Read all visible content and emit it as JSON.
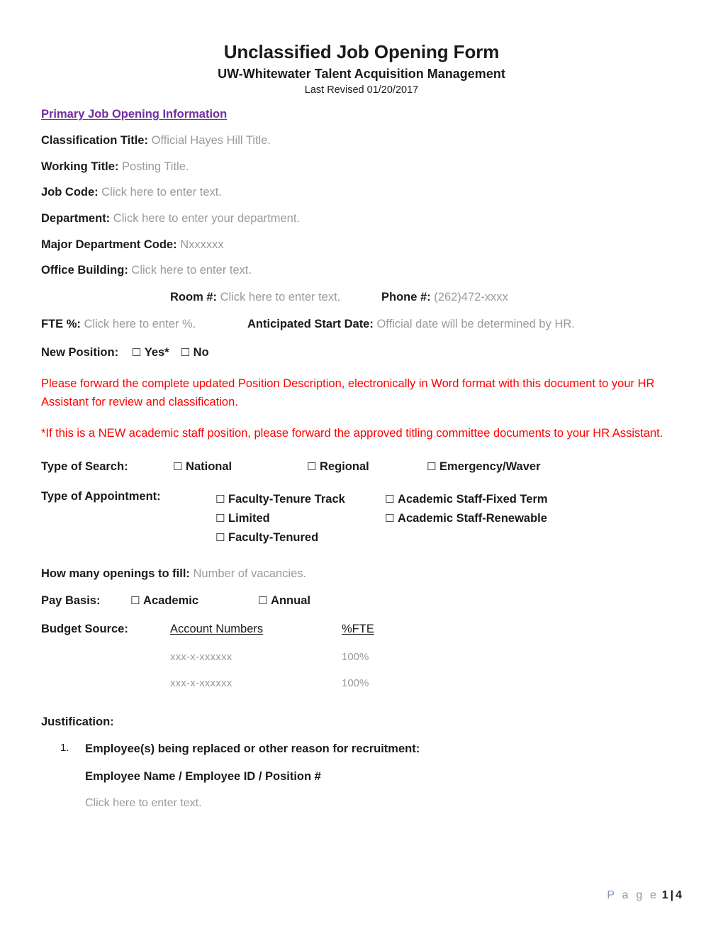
{
  "document": {
    "title": "Unclassified Job Opening Form",
    "subtitle": "UW-Whitewater Talent Acquisition Management",
    "revised": "Last Revised 01/20/2017"
  },
  "section": {
    "heading": "Primary Job Opening Information"
  },
  "checkbox_glyph": "☐",
  "fields": {
    "classification_title": {
      "label": "Classification Title:",
      "placeholder": "Official Hayes Hill Title."
    },
    "working_title": {
      "label": "Working Title:",
      "placeholder": "Posting Title."
    },
    "job_code": {
      "label": "Job Code:",
      "placeholder": "Click here to enter text."
    },
    "department": {
      "label": "Department:",
      "placeholder": "Click here to enter your department."
    },
    "major_department_code": {
      "label": "Major Department Code:",
      "placeholder": "Nxxxxxx"
    },
    "office_building": {
      "label": "Office Building:",
      "placeholder": "Click here to enter text."
    },
    "room": {
      "label": "Room #:",
      "placeholder": "Click here to enter text."
    },
    "phone": {
      "label": "Phone #:",
      "placeholder": "(262)472-xxxx"
    },
    "fte_percent": {
      "label": "FTE %:",
      "placeholder": "Click here to enter %."
    },
    "anticipated_start_date": {
      "label": "Anticipated Start Date:",
      "placeholder": "Official date will be determined by HR."
    },
    "openings": {
      "label": "How many openings to fill:",
      "placeholder": "Number of vacancies."
    }
  },
  "new_position": {
    "label": "New Position:",
    "options": [
      {
        "label": "Yes*",
        "checked": false
      },
      {
        "label": "No",
        "checked": false
      }
    ]
  },
  "notices": [
    "Please forward the complete updated Position Description, electronically in Word format with this document to your HR Assistant for review and classification.",
    "*If this is a NEW academic staff position, please forward the approved titling committee documents to your HR Assistant."
  ],
  "notice_color": "#FF0000",
  "type_of_search": {
    "label": "Type of Search:",
    "options": [
      {
        "label": "National",
        "checked": false
      },
      {
        "label": "Regional",
        "checked": false
      },
      {
        "label": "Emergency/Waver",
        "checked": false
      }
    ]
  },
  "type_of_appointment": {
    "label": "Type of Appointment:",
    "column1": [
      {
        "label": "Faculty-Tenure Track",
        "checked": false
      },
      {
        "label": "Limited",
        "checked": false
      },
      {
        "label": "Faculty-Tenured",
        "checked": false
      }
    ],
    "column2": [
      {
        "label": "Academic Staff-Fixed Term",
        "checked": false
      },
      {
        "label": "Academic Staff-Renewable",
        "checked": false
      }
    ]
  },
  "pay_basis": {
    "label": "Pay Basis:",
    "options": [
      {
        "label": "Academic",
        "checked": false
      },
      {
        "label": "Annual",
        "checked": false
      }
    ]
  },
  "budget_source": {
    "label": "Budget Source:",
    "headers": {
      "accounts": "Account Numbers",
      "fte": "%FTE"
    },
    "rows": [
      {
        "account": "xxx-x-xxxxxx",
        "fte": "100%"
      },
      {
        "account": "xxx-x-xxxxxx",
        "fte": "100%"
      }
    ]
  },
  "justification": {
    "title": "Justification:",
    "items": [
      {
        "number": "1.",
        "text": "Employee(s) being replaced or other reason for recruitment:",
        "subtext": "Employee Name / Employee ID / Position #",
        "placeholder": "Click here to enter text."
      }
    ]
  },
  "footer": {
    "page_word": "P a g e",
    "current_page": "1",
    "separator": "|",
    "total_pages": "4"
  },
  "colors": {
    "heading_purple": "#7030A0",
    "notice_red": "#FF0000",
    "placeholder_gray": "#9A9A9A",
    "footer_blue": "#8496B0"
  }
}
